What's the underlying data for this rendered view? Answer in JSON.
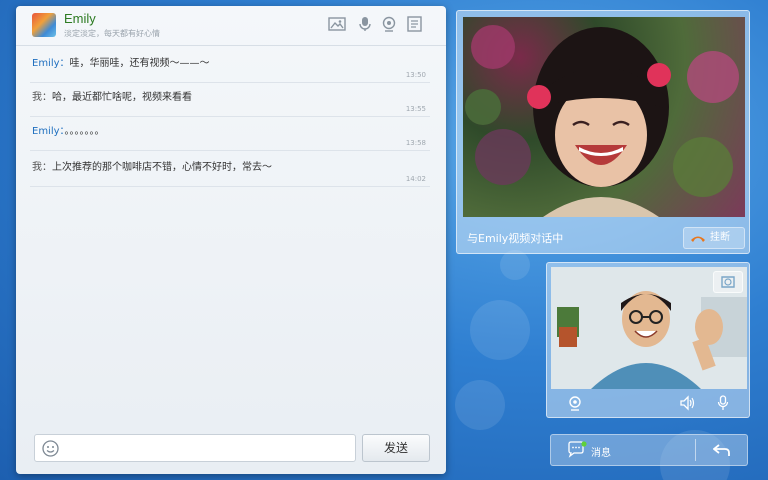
{
  "chat": {
    "contact_name": "Emily",
    "contact_signature": "淡定淡定，每天都有好心情",
    "messages": [
      {
        "sender": "Emily",
        "text": "哇，华丽哇，还有视频～——～",
        "time": "13:50"
      },
      {
        "sender": "我",
        "text": "哈，最近都忙啥呢，视频来看看",
        "time": "13:55"
      },
      {
        "sender": "Emily",
        "text": "。。。。。。。",
        "time": "13:58"
      },
      {
        "sender": "我",
        "text": "上次推荐的那个咖啡店不错，心情不好时，常去～",
        "time": "14:02"
      }
    ],
    "input_placeholder": "",
    "send_label": "发送",
    "header_icons": [
      "image-icon",
      "microphone-icon",
      "webcam-icon",
      "document-icon"
    ]
  },
  "remote_video": {
    "caption": "与Emily视频对话中",
    "hangup_label": "挂断"
  },
  "local_video": {
    "controls": [
      "webcam-icon",
      "speaker-icon",
      "microphone-icon"
    ]
  },
  "bottom_bar": {
    "messages_label": "消息"
  },
  "colors": {
    "accent_name": "#2d7b22",
    "sender_blue": "#1f6fbf",
    "background": "#2f7fd1",
    "hangup_orange": "#e8761c",
    "online_green": "#5fd13a"
  }
}
